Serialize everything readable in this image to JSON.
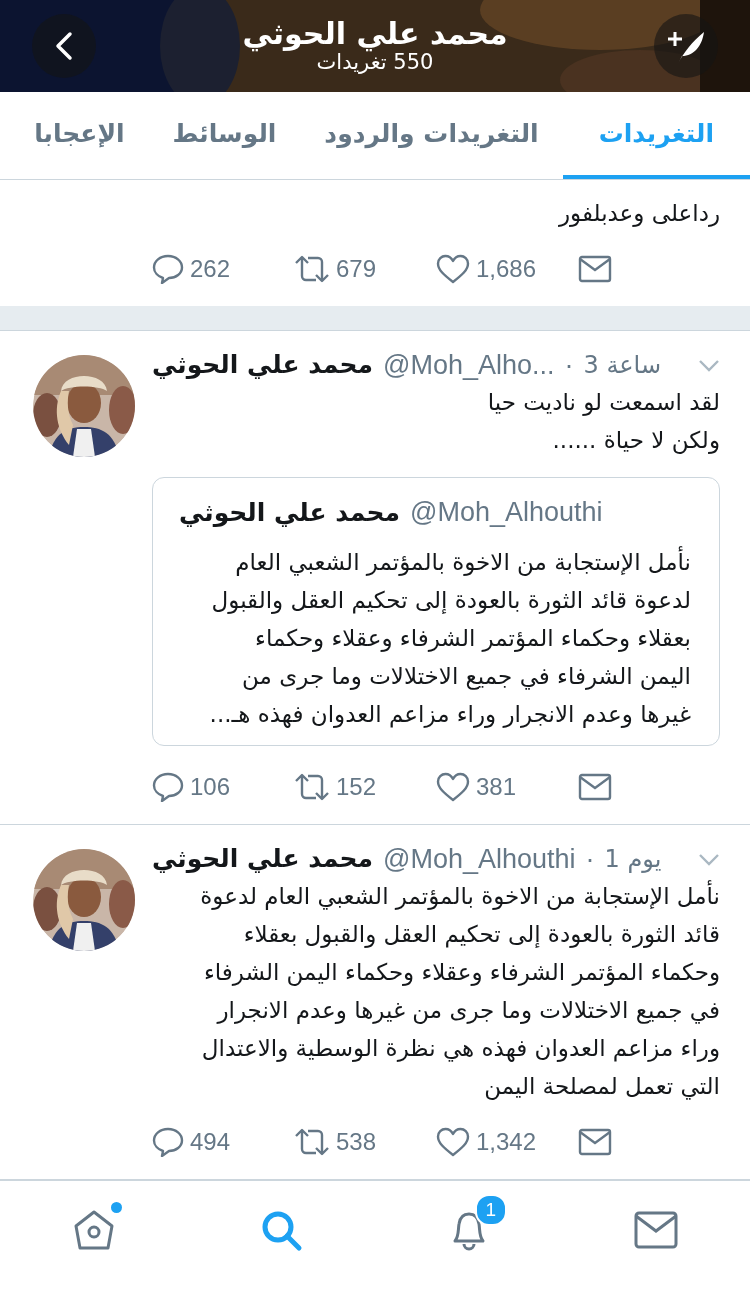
{
  "header": {
    "title": "محمد علي الحوثي",
    "subtitle": "550 تغريدات"
  },
  "tabs": [
    {
      "label": "التغريدات",
      "selected": true
    },
    {
      "label": "التغريدات والردود",
      "selected": false
    },
    {
      "label": "الوسائط",
      "selected": false
    },
    {
      "label": "الإعجابا",
      "selected": false
    }
  ],
  "tweets": [
    {
      "kind": "partial",
      "text": "رداعلى وعدبلفور",
      "replies": "262",
      "retweets": "679",
      "likes": "1,686"
    },
    {
      "kind": "full",
      "name": "محمد علي الحوثي",
      "handle": "@Moh_Alho...",
      "separator": "·",
      "time": "3 ساعة",
      "text": "لقد اسمعت لو ناديت حيا\nولكن لا حياة ......",
      "quote": {
        "name": "محمد علي الحوثي",
        "handle": "@Moh_Alhouthi",
        "text": "نأمل الإستجابة من الاخوة بالمؤتمر الشعبي العام\nلدعوة قائد الثورة بالعودة إلى تحكيم العقل والقبول\nبعقلاء وحكماء  المؤتمر الشرفاء وعقلاء وحكماء\nاليمن الشرفاء في جميع الاختلالات وما جرى من\nغيرها وعدم الانجرار وراء مزاعم العدوان فهذه هـ..."
      },
      "replies": "106",
      "retweets": "152",
      "likes": "381"
    },
    {
      "kind": "full",
      "name": "محمد علي الحوثي",
      "handle": "@Moh_Alhouthi",
      "separator": "·",
      "time": "1 يوم",
      "text": "نأمل الإستجابة من الاخوة بالمؤتمر الشعبي العام لدعوة\nقائد الثورة بالعودة إلى تحكيم العقل والقبول بعقلاء\nوحكماء  المؤتمر الشرفاء وعقلاء وحكماء اليمن الشرفاء\nفي جميع الاختلالات وما جرى من غيرها وعدم الانجرار\nوراء مزاعم العدوان فهذه هي نظرة الوسطية والاعتدال\nالتي تعمل لمصلحة اليمن",
      "replies": "494",
      "retweets": "538",
      "likes": "1,342"
    }
  ],
  "bottom_nav": [
    {
      "kind": "home",
      "selected": false,
      "dot": true
    },
    {
      "kind": "search",
      "selected": true
    },
    {
      "kind": "notifications",
      "selected": false,
      "badge": "1"
    },
    {
      "kind": "messages",
      "selected": false
    }
  ]
}
